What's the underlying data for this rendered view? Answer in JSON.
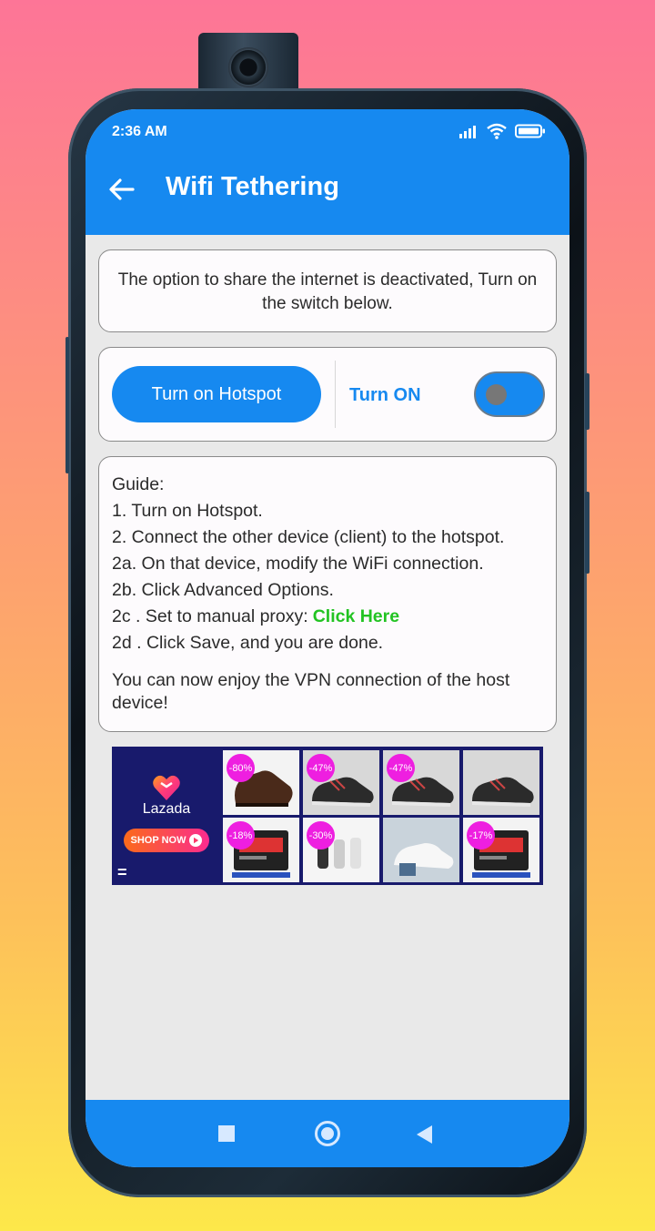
{
  "status_bar": {
    "time": "2:36 AM"
  },
  "app_bar": {
    "title": "Wifi Tethering"
  },
  "notice": {
    "text": "The option to share the internet is deactivated, Turn on the switch below."
  },
  "hotspot": {
    "button_label": "Turn on Hotspot",
    "toggle_label": "Turn ON",
    "switch_on": false
  },
  "guide": {
    "heading": "Guide:",
    "steps": [
      "1. Turn on Hotspot.",
      "2. Connect the other device (client) to the hotspot.",
      "2a. On that device, modify the WiFi connection.",
      "2b. Click Advanced Options.",
      "2c . Set to manual proxy:",
      "2d . Click Save, and you are done."
    ],
    "link_label": "Click Here",
    "outro": "You can now enjoy the VPN connection of the host device!"
  },
  "ad": {
    "brand": "Lazada",
    "cta": "SHOP NOW",
    "tiles": [
      {
        "badge": "-80%",
        "product": "shoe"
      },
      {
        "badge": "-47%",
        "product": "sneaker"
      },
      {
        "badge": "-47%",
        "product": "sneaker"
      },
      {
        "badge": "",
        "product": "sneaker"
      },
      {
        "badge": "-18%",
        "product": "battery"
      },
      {
        "badge": "-30%",
        "product": "socks"
      },
      {
        "badge": "",
        "product": "white-sneaker"
      },
      {
        "badge": "-17%",
        "product": "battery"
      }
    ]
  },
  "colors": {
    "primary": "#1689f0",
    "link": "#22c322",
    "badge": "#ee1fe0",
    "ad_bg": "#181a6c"
  }
}
